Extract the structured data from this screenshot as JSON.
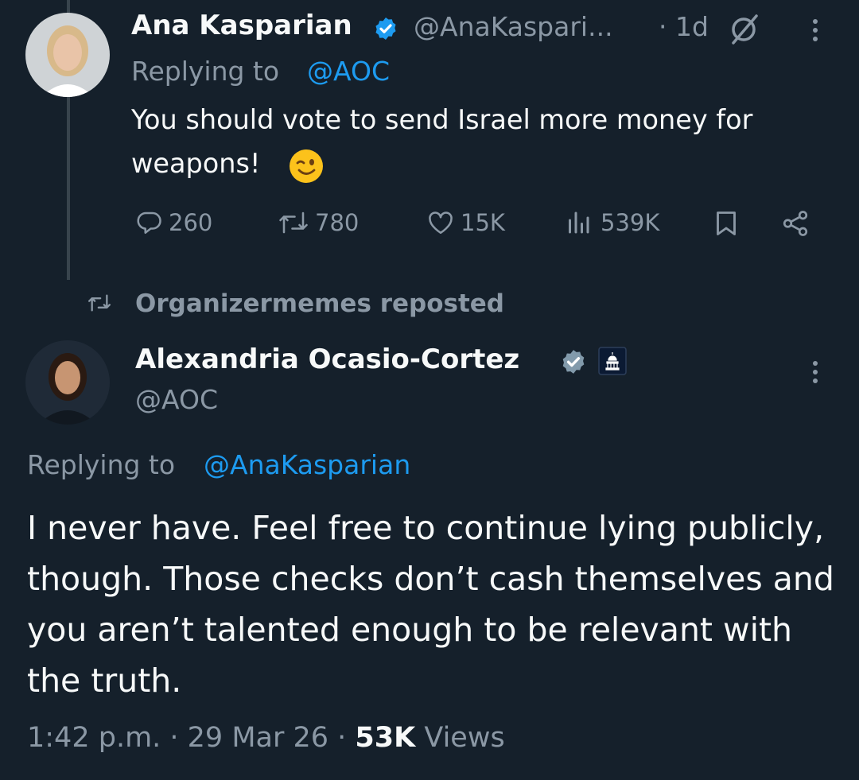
{
  "tweet1": {
    "display_name": "Ana Kasparian",
    "handle": "@AnaKaspari...",
    "time": "· 1d",
    "replying_prefix": "Replying to",
    "replying_handle": "@AOC",
    "text_line1": "You should vote to send Israel more money for",
    "text_line2": "weapons!",
    "emoji": "😉",
    "stats": {
      "replies": "260",
      "reposts": "780",
      "likes": "15K",
      "views": "539K"
    }
  },
  "repost_label": "Organizermemes reposted",
  "tweet2": {
    "display_name": "Alexandria Ocasio-Cortez",
    "handle": "@AOC",
    "replying_prefix": "Replying to",
    "replying_handle": "@AnaKasparian",
    "text": "I never have. Feel free to continue lying publicly, though. Those checks don’t cash themselves and you aren’t talented enough to be relevant with the truth.",
    "timestamp": "1:42 p.m. · 29 Mar 26 ·",
    "views_count": "53K",
    "views_label": "Views"
  },
  "colors": {
    "background": "#15202b",
    "text_primary": "#f7f9f9",
    "text_secondary": "#8b98a5",
    "accent": "#1d9bf0",
    "verified_badge_1": "#1d9bf0",
    "verified_badge_2": "#829aab"
  },
  "icons": [
    "verified-badge-icon",
    "grok-icon",
    "more-icon",
    "reply-icon",
    "repost-icon",
    "like-icon",
    "views-icon",
    "bookmark-icon",
    "share-icon",
    "affiliate-badge-icon"
  ]
}
